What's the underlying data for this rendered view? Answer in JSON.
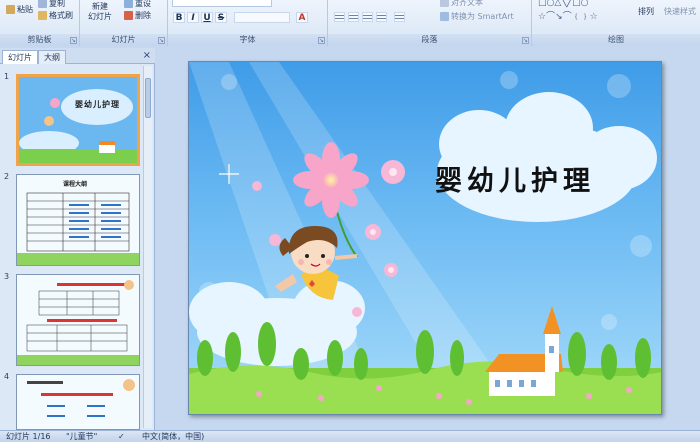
{
  "ribbon": {
    "clipboard": {
      "label": "剪贴板",
      "paste": "粘贴",
      "copy": "复制",
      "format_painter": "格式刷"
    },
    "slides": {
      "label": "幻灯片",
      "new_slide": "新建",
      "new_slide_2": "幻灯片",
      "reset": "重设",
      "delete": "删除"
    },
    "font": {
      "label": "字体",
      "bold": "B",
      "italic": "I",
      "underline": "U",
      "strike": "S"
    },
    "paragraph": {
      "label": "段落",
      "text_direction": "对齐文本",
      "smartart": "转换为 SmartArt"
    },
    "drawing": {
      "label": "绘图",
      "arrange": "排列",
      "quick_styles": "快速样式"
    }
  },
  "panel": {
    "tab_slides": "幻灯片",
    "tab_outline": "大纲",
    "close": "×",
    "thumbnails": [
      {
        "num": "1",
        "title": "婴幼儿护理"
      },
      {
        "num": "2",
        "title": "课程大纲"
      },
      {
        "num": "3"
      },
      {
        "num": "4"
      }
    ]
  },
  "slide": {
    "title": "婴幼儿护理"
  },
  "status": {
    "slide_info": "幻灯片 1/16",
    "theme": "\"儿童节\"",
    "language": "中文(简体，中国)"
  },
  "colors": {
    "accent": "#f0a44a",
    "ribbon_border": "#9ab3d6",
    "sky": "#3f9ce8"
  }
}
